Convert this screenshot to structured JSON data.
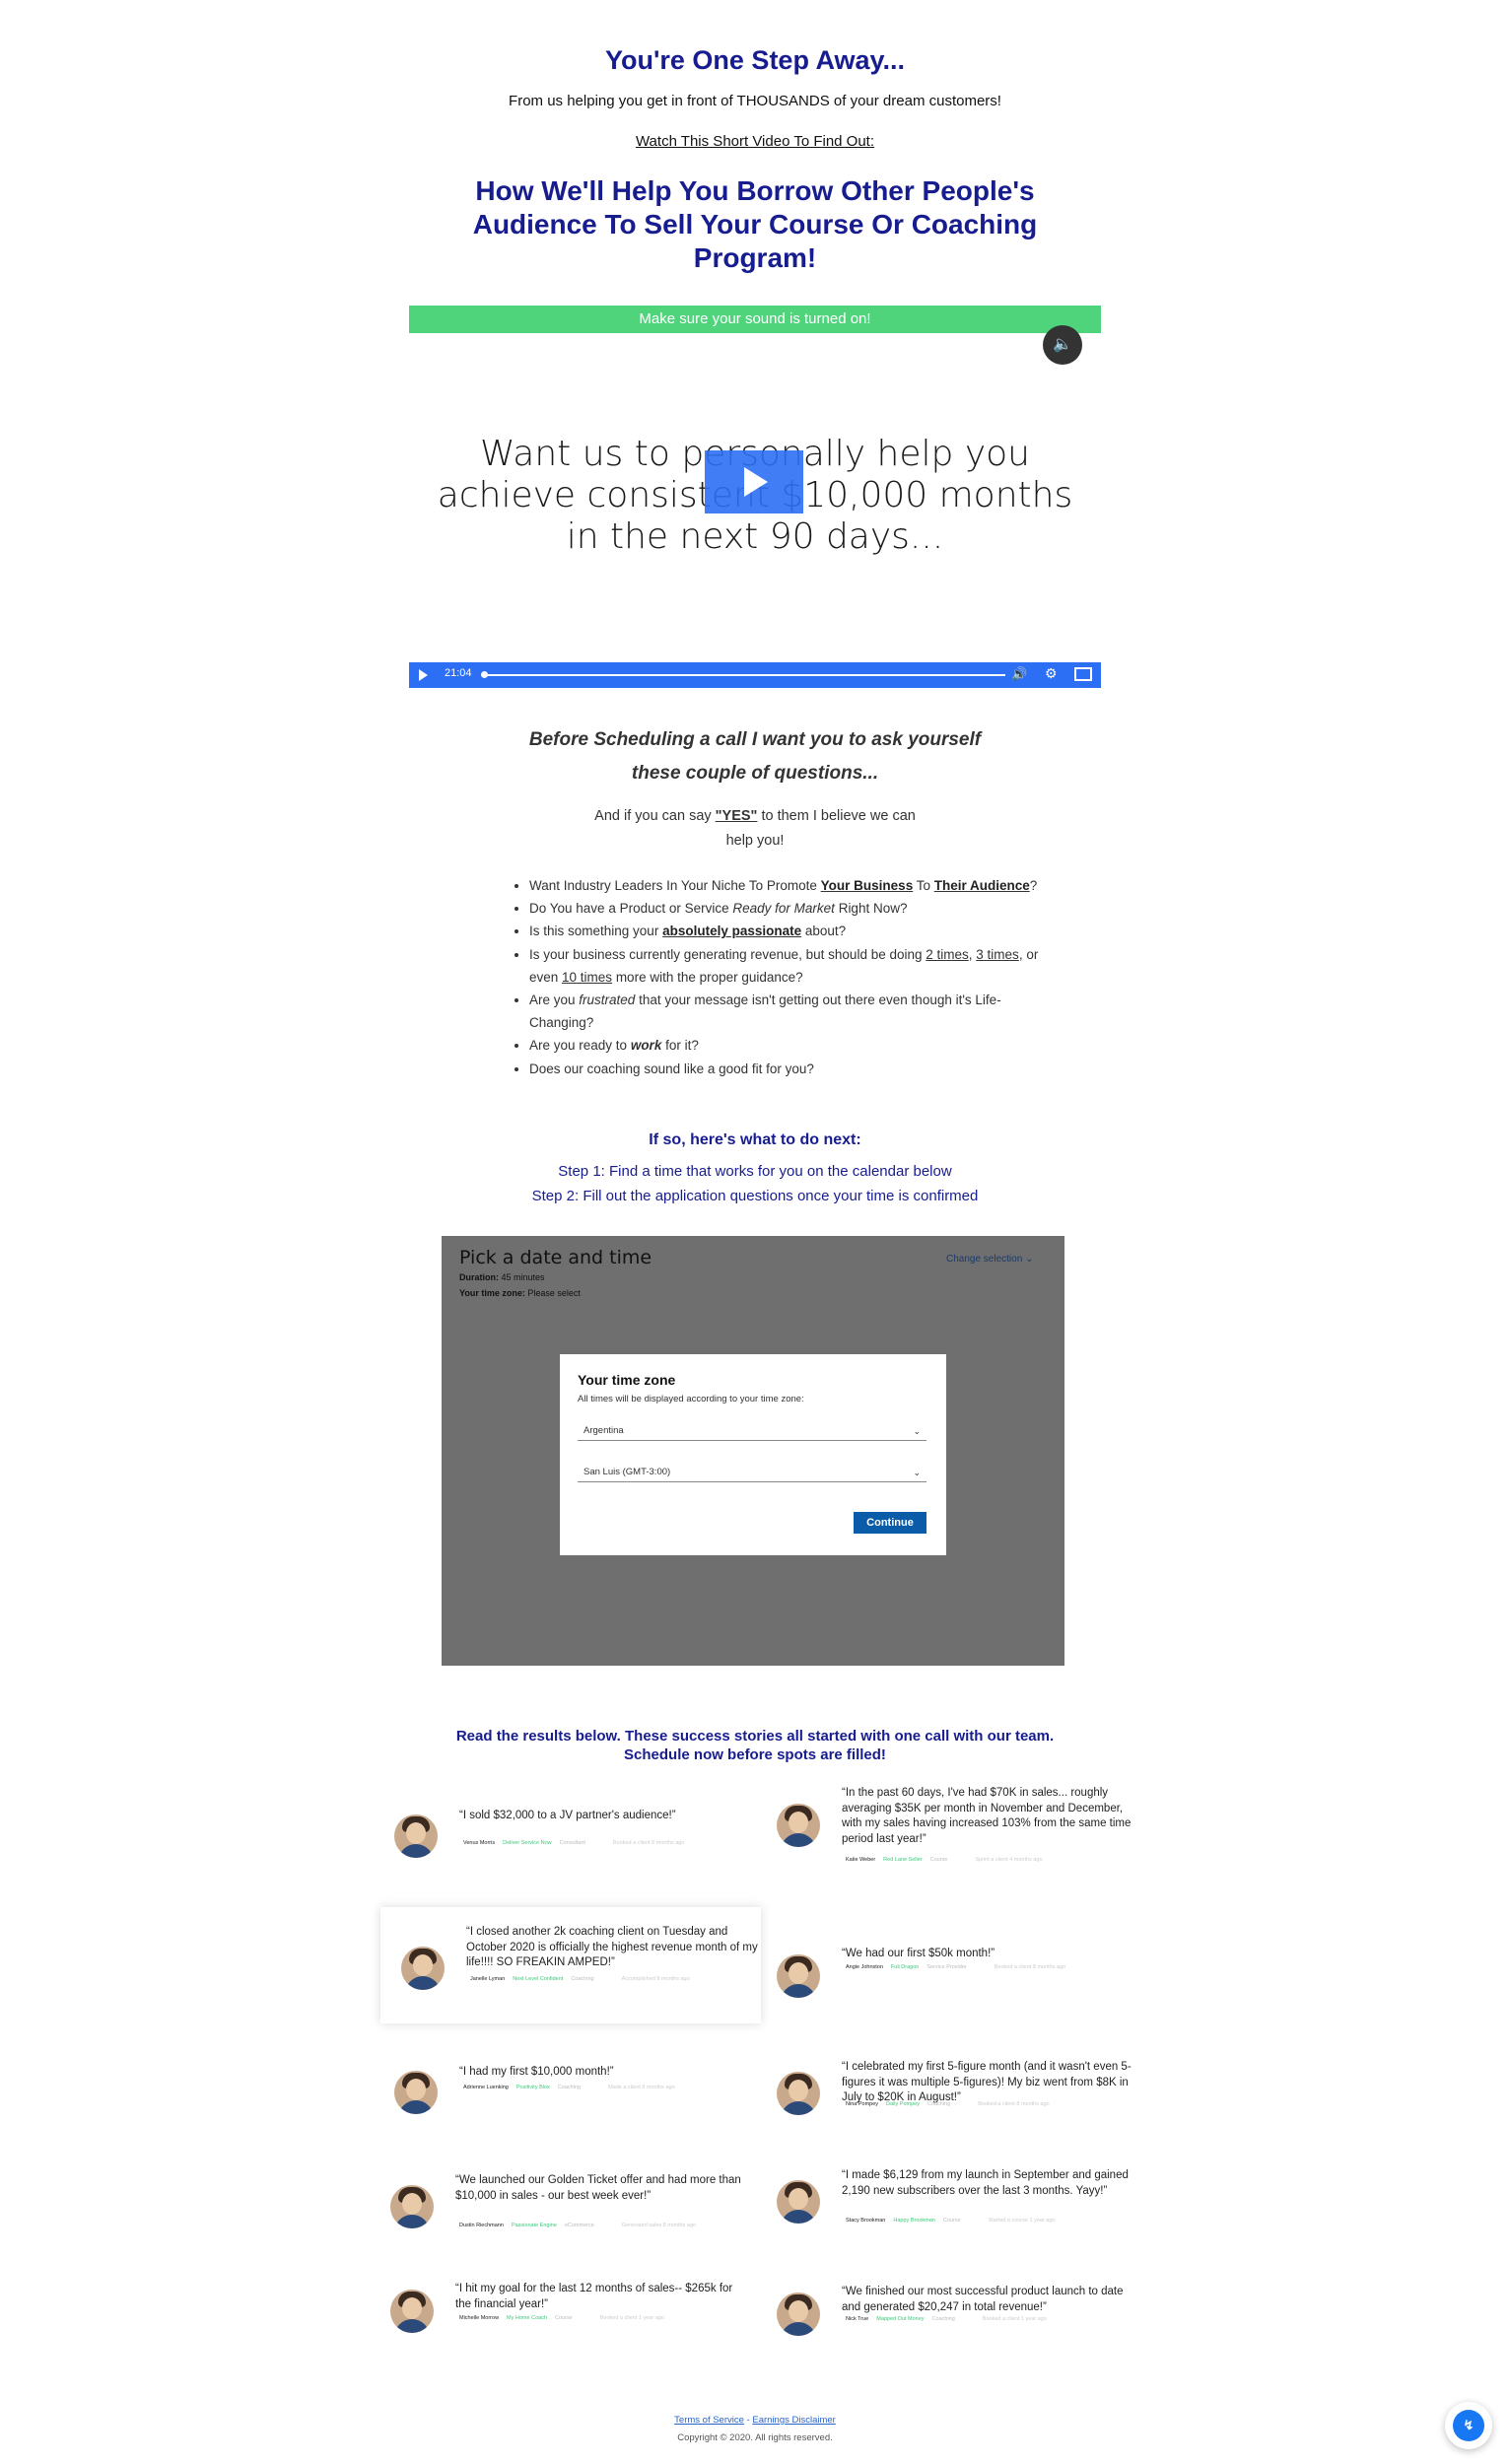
{
  "header": {
    "step_title": "You're One Step Away...",
    "subtitle": "From us helping you get in front of THOUSANDS of your dream customers!",
    "watch_text": "Watch This Short Video To Find Out:",
    "main_headline": "How We'll Help You Borrow Other People's Audience To Sell Your Course Or Coaching Program!"
  },
  "video": {
    "sound_notice": "Make sure your sound is turned on!",
    "overlay_text": "Want us to personally help you achieve consistent $10,000 months in the next 90 days...",
    "duration": "21:04",
    "progress": 0
  },
  "questions": {
    "heading": "Before Scheduling a call I want you to ask yourself these couple of questions...",
    "yes_pre": "And if you can say ",
    "yes_word": "\"YES\"",
    "yes_post": " to them I believe we can help you!",
    "items": [
      {
        "a": "Want Industry Leaders In Your Niche To Promote ",
        "b": "Your Business",
        "c": " To ",
        "d": "Their Audience",
        "e": "?"
      },
      {
        "a": "Do You have a Product or Service ",
        "b": "Ready for Market",
        "c": " Right Now?"
      },
      {
        "a": "Is this something your ",
        "b": "absolutely passionate",
        "c": " about?"
      },
      {
        "a": "Is your business currently generating revenue, but should be doing ",
        "b": "2 times",
        "c": ", ",
        "d": "3 times",
        "e": ", or even ",
        "f": "10 times",
        "g": " more with the proper guidance?"
      },
      {
        "a": "Are you ",
        "b": "frustrated",
        "c": " that your message isn't getting out there even though it's Life-Changing?"
      },
      {
        "a": "Are you ready to ",
        "b": "work",
        "c": " for it?"
      },
      {
        "a": "Does our coaching sound like a good fit for you?"
      }
    ]
  },
  "next_steps": {
    "heading": "If so, here's what to do next:",
    "step1": "Step 1: Find a time that works for you on the calendar below",
    "step2": "Step 2: Fill out the application questions once your time is confirmed"
  },
  "calendar": {
    "title": "Pick a date and time",
    "duration_label": "Duration:",
    "duration_value": " 45 minutes",
    "timezone_label": "Your time zone:",
    "timezone_value": " Please select",
    "change_selection": "Change selection",
    "modal": {
      "title": "Your time zone",
      "description": "All times will be displayed according to your time zone:",
      "country": "Argentina",
      "city": "San Luis (GMT-3:00)",
      "continue_label": "Continue"
    }
  },
  "results": {
    "heading": "Read the results below. These success stories all started with one call with our team. Schedule now before spots are filled!",
    "testimonials": [
      {
        "quote": "“I sold $32,000 to a JV partner's audience!”",
        "name": "Venus Morris",
        "link": "Deliver Service Now",
        "tag": "Consultant",
        "date": "Booked a client 8 months ago"
      },
      {
        "quote": "“In the past 60 days, I've had $70K in sales... roughly averaging $35K per month in November and December, with my sales having increased 103% from the same time period last year!”",
        "name": "Katie Weber",
        "link": "Red Lane Seller",
        "tag": "Course",
        "date": "Sprint a client 4 months ago"
      },
      {
        "quote": "“I closed another 2k coaching client on Tuesday and October 2020 is officially the highest revenue month of my life!!!! SO FREAKIN AMPED!”",
        "name": "Janelle Lyman",
        "link": "Next Level Confident",
        "tag": "Coaching",
        "date": "Accomplished 8 months ago"
      },
      {
        "quote": "“We had our first $50k month!”",
        "name": "Angie Johnston",
        "link": "Fuli Dragon",
        "tag": "Service Provider",
        "date": "Booked a client 8 months ago"
      },
      {
        "quote": "“I had my first $10,000 month!”",
        "name": "Adrienne Luenking",
        "link": "Positivity Blox",
        "tag": "Coaching",
        "date": "Made a client 8 months ago"
      },
      {
        "quote": "“I celebrated my first 5-figure month (and it wasn't even 5-figures it was multiple 5-figures)! My biz went from $8K in July to $20K in August!”",
        "name": "Nina Pompey",
        "link": "Daily Pompey",
        "tag": "Coaching",
        "date": "Booked a client 8 months ago"
      },
      {
        "quote": "“We launched our Golden Ticket offer and had more than $10,000 in sales - our best week ever!”",
        "name": "Dustin Riechmann",
        "link": "Passionate Engine",
        "tag": "eCommerce",
        "date": "Generated sales 8 months ago"
      },
      {
        "quote": "“I made $6,129 from my launch in September and gained 2,190 new subscribers over the last 3 months. Yayy!”",
        "name": "Stacy Brookman",
        "link": "Happy Brookman",
        "tag": "Course",
        "date": "Started a course 1 year ago"
      },
      {
        "quote": "“I hit my goal for the last 12 months of sales-- $265k for the financial year!”",
        "name": "Michelle Morrow",
        "link": "My Home Coach",
        "tag": "Course",
        "date": "Booked a client 1 year ago"
      },
      {
        "quote": "“We finished our most successful product launch to date and generated $20,247 in total revenue!”",
        "name": "Nick True",
        "link": "Mapped Out Money",
        "tag": "Coaching",
        "date": "Booked a client 1 year ago"
      }
    ]
  },
  "footer": {
    "terms": "Terms of Service",
    "separator": " - ",
    "disclaimer": "Earnings Disclaimer",
    "copyright": "Copyright © 2020. All rights reserved."
  },
  "colors": {
    "accent_navy": "#171c8f",
    "sound_bar": "#4fd47c",
    "video_blue": "#2c6ff4",
    "continue_button": "#0a5ca8",
    "messenger": "#1877f2"
  },
  "icons": [
    "speaker-icon",
    "play-icon",
    "volume-icon",
    "gear-icon",
    "fullscreen-icon",
    "chevron-down-icon",
    "messenger-icon"
  ]
}
